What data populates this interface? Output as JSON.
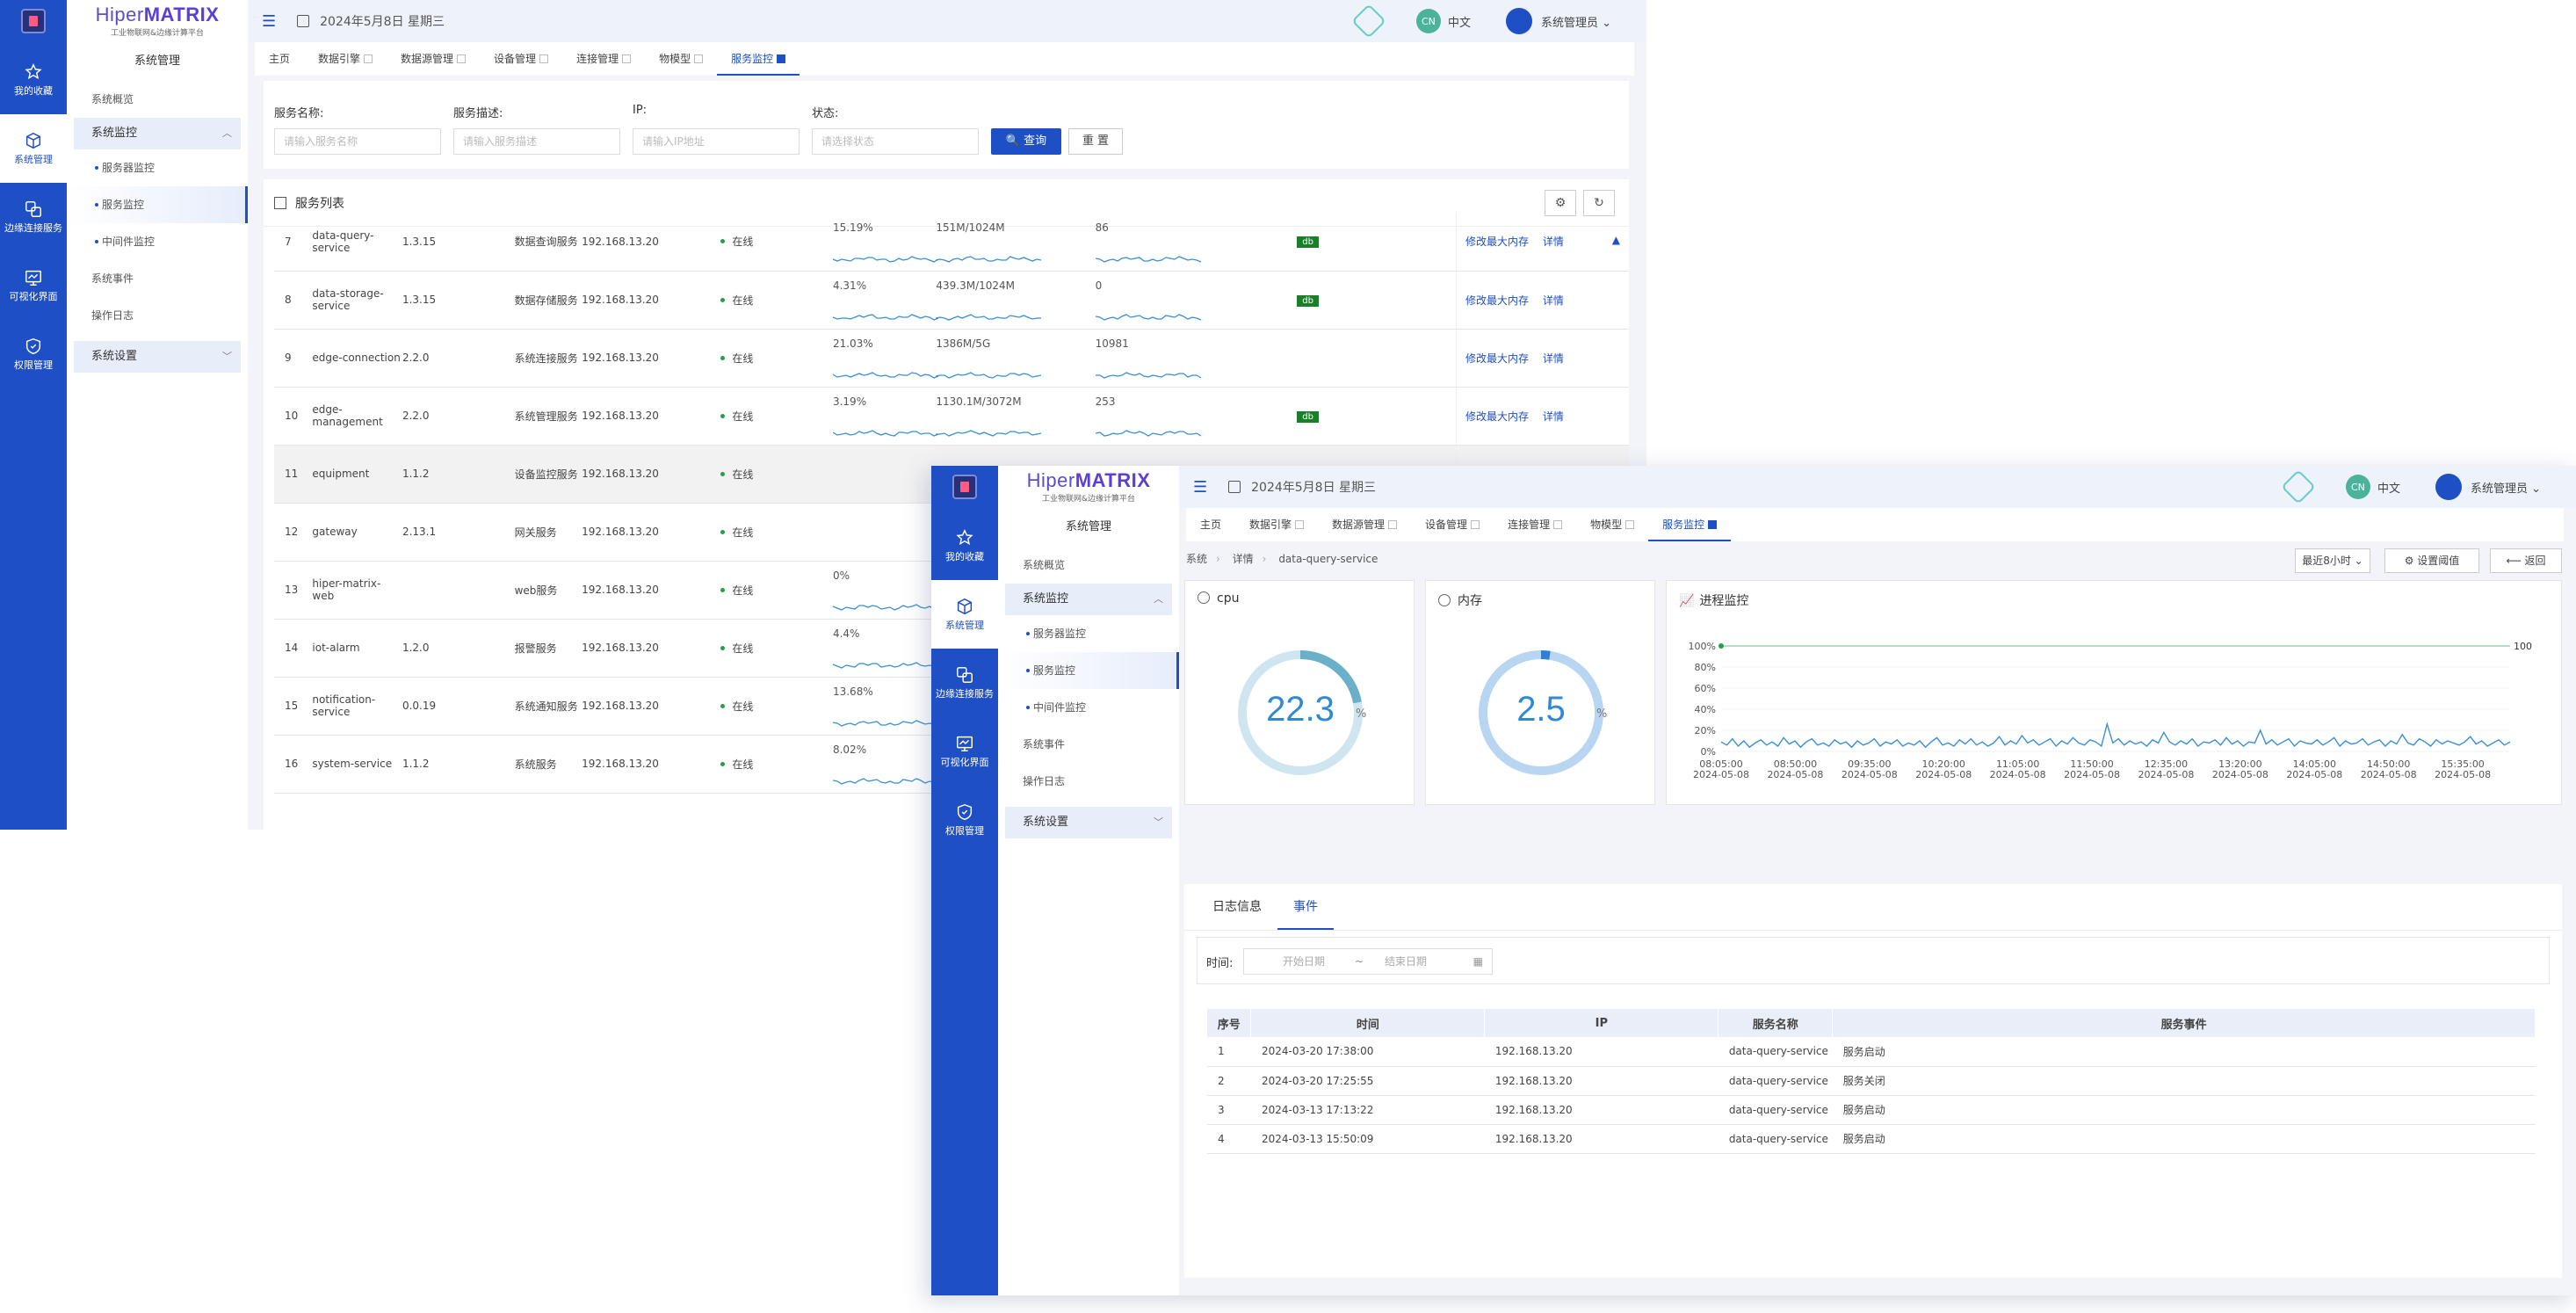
{
  "common": {
    "brand_main": "Hiper",
    "brand_accent": "MATRIX",
    "brand_sub": "工业物联网&边缘计算平台",
    "date": "2024年5月8日 星期三",
    "lang_badge": "CN",
    "lang_label": "中文",
    "user_label": "系统管理员 ⌄",
    "rail": [
      {
        "label": "我的收藏",
        "icon": "star-icon"
      },
      {
        "label": "系统管理",
        "icon": "cube-icon"
      },
      {
        "label": "边缘连接服务",
        "icon": "link-icon"
      },
      {
        "label": "可视化界面",
        "icon": "monitor-icon"
      },
      {
        "label": "权限管理",
        "icon": "shield-icon"
      }
    ],
    "sidebar": {
      "title": "系统管理",
      "overview": "系统概览",
      "monitor_group": "系统监控",
      "subs": [
        "服务器监控",
        "服务监控",
        "中间件监控"
      ],
      "events": "系统事件",
      "oplog": "操作日志",
      "settings": "系统设置"
    },
    "tabs": [
      "主页",
      "数据引擎",
      "数据源管理",
      "设备管理",
      "连接管理",
      "物模型",
      "服务监控"
    ]
  },
  "list_page": {
    "filters": {
      "name_label": "服务名称:",
      "name_placeholder": "请输入服务名称",
      "desc_label": "服务描述:",
      "desc_placeholder": "请输入服务描述",
      "ip_label": "IP:",
      "ip_placeholder": "请输入IP地址",
      "status_label": "状态:",
      "status_placeholder": "请选择状态",
      "query_button": "🔍 查询",
      "reset_button": "重 置"
    },
    "list_title": "服务列表",
    "rows": [
      {
        "no": "7",
        "name": "data-query-service",
        "ver": "1.3.15",
        "desc": "数据查询服务",
        "ip": "192.168.13.20",
        "status": "在线",
        "cpu": "15.19%",
        "mem": "151M/1024M",
        "thr": "86",
        "tag": "db",
        "mod": "修改最大内存",
        "detail": "详情"
      },
      {
        "no": "8",
        "name": "data-storage-service",
        "ver": "1.3.15",
        "desc": "数据存储服务",
        "ip": "192.168.13.20",
        "status": "在线",
        "cpu": "4.31%",
        "mem": "439.3M/1024M",
        "thr": "0",
        "tag": "db",
        "mod": "修改最大内存",
        "detail": "详情"
      },
      {
        "no": "9",
        "name": "edge-connection",
        "ver": "2.2.0",
        "desc": "系统连接服务",
        "ip": "192.168.13.20",
        "status": "在线",
        "cpu": "21.03%",
        "mem": "1386M/5G",
        "thr": "10981",
        "tag": "",
        "mod": "修改最大内存",
        "detail": "详情"
      },
      {
        "no": "10",
        "name": "edge-management",
        "ver": "2.2.0",
        "desc": "系统管理服务",
        "ip": "192.168.13.20",
        "status": "在线",
        "cpu": "3.19%",
        "mem": "1130.1M/3072M",
        "thr": "253",
        "tag": "db",
        "mod": "修改最大内存",
        "detail": "详情"
      },
      {
        "no": "11",
        "name": "equipment",
        "ver": "1.1.2",
        "desc": "设备监控服务",
        "ip": "192.168.13.20",
        "status": "在线",
        "cpu": "",
        "mem": "",
        "thr": "",
        "tag": "",
        "mod": "",
        "detail": ""
      },
      {
        "no": "12",
        "name": "gateway",
        "ver": "2.13.1",
        "desc": "网关服务",
        "ip": "192.168.13.20",
        "status": "在线",
        "cpu": "",
        "mem": "",
        "thr": "",
        "tag": "",
        "mod": "",
        "detail": ""
      },
      {
        "no": "13",
        "name": "hiper-matrix-web",
        "ver": "",
        "desc": "web服务",
        "ip": "192.168.13.20",
        "status": "在线",
        "cpu": "0%",
        "mem": "",
        "thr": "",
        "tag": "",
        "mod": "",
        "detail": ""
      },
      {
        "no": "14",
        "name": "iot-alarm",
        "ver": "1.2.0",
        "desc": "报警服务",
        "ip": "192.168.13.20",
        "status": "在线",
        "cpu": "4.4%",
        "mem": "",
        "thr": "",
        "tag": "",
        "mod": "",
        "detail": ""
      },
      {
        "no": "15",
        "name": "notification-service",
        "ver": "0.0.19",
        "desc": "系统通知服务",
        "ip": "192.168.13.20",
        "status": "在线",
        "cpu": "13.68%",
        "mem": "",
        "thr": "",
        "tag": "",
        "mod": "",
        "detail": ""
      },
      {
        "no": "16",
        "name": "system-service",
        "ver": "1.1.2",
        "desc": "系统服务",
        "ip": "192.168.13.20",
        "status": "在线",
        "cpu": "8.02%",
        "mem": "",
        "thr": "",
        "tag": "",
        "mod": "",
        "detail": ""
      }
    ]
  },
  "detail_page": {
    "breadcrumb": [
      "系统",
      "详情",
      "data-query-service"
    ],
    "range_select": "最近8小时 ⌄",
    "threshold_button": "⚙ 设置阈值",
    "back_button": "⟵ 返回",
    "cpu_title": "cpu",
    "cpu_value": "22.3",
    "cpu_unit": "%",
    "mem_title": "内存",
    "mem_value": "2.5",
    "mem_unit": "%",
    "proc_title": "进程监控",
    "event_tabs": [
      "日志信息",
      "事件"
    ],
    "time_label": "时间:",
    "start_placeholder": "开始日期",
    "end_placeholder": "结束日期",
    "event_headers": [
      "序号",
      "时间",
      "IP",
      "服务名称",
      "服务事件"
    ],
    "events": [
      {
        "no": "1",
        "time": "2024-03-20 17:38:00",
        "ip": "192.168.13.20",
        "svc": "data-query-service",
        "ev": "服务启动"
      },
      {
        "no": "2",
        "time": "2024-03-20 17:25:55",
        "ip": "192.168.13.20",
        "svc": "data-query-service",
        "ev": "服务关闭"
      },
      {
        "no": "3",
        "time": "2024-03-13 17:13:22",
        "ip": "192.168.13.20",
        "svc": "data-query-service",
        "ev": "服务启动"
      },
      {
        "no": "4",
        "time": "2024-03-13 15:50:09",
        "ip": "192.168.13.20",
        "svc": "data-query-service",
        "ev": "服务启动"
      }
    ]
  },
  "chart_data": {
    "type": "line",
    "title": "进程监控",
    "y_ticks": [
      "100%",
      "80%",
      "60%",
      "40%",
      "20%",
      "0%"
    ],
    "ylim": [
      0,
      100
    ],
    "x_ticks": [
      [
        "08:05:00",
        "2024-05-08"
      ],
      [
        "08:50:00",
        "2024-05-08"
      ],
      [
        "09:35:00",
        "2024-05-08"
      ],
      [
        "10:20:00",
        "2024-05-08"
      ],
      [
        "11:05:00",
        "2024-05-08"
      ],
      [
        "11:50:00",
        "2024-05-08"
      ],
      [
        "12:35:00",
        "2024-05-08"
      ],
      [
        "13:20:00",
        "2024-05-08"
      ],
      [
        "14:05:00",
        "2024-05-08"
      ],
      [
        "14:50:00",
        "2024-05-08"
      ],
      [
        "15:35:00",
        "2024-05-08"
      ]
    ],
    "threshold": 100,
    "threshold_label": "100",
    "series": [
      {
        "values": [
          9,
          6,
          12,
          5,
          10,
          4,
          8,
          11,
          6,
          9,
          5,
          13,
          7,
          10,
          4,
          9,
          12,
          6,
          8,
          5,
          11,
          7,
          9,
          4,
          10,
          6,
          8,
          12,
          5,
          9,
          7,
          11,
          5,
          8,
          6,
          10,
          4,
          9,
          13,
          6,
          8,
          5,
          11,
          7,
          12,
          6,
          9,
          5,
          8,
          14,
          6,
          10,
          7,
          15,
          8,
          11,
          6,
          9,
          12,
          5,
          10,
          7,
          13,
          8,
          6,
          11,
          9,
          5,
          26,
          8,
          12,
          6,
          10,
          7,
          9,
          5,
          11,
          8,
          18,
          9,
          6,
          10,
          7,
          12,
          5,
          9,
          8,
          11,
          6,
          13,
          7,
          10,
          5,
          9,
          8,
          20,
          7,
          11,
          6,
          9,
          12,
          5,
          10,
          8,
          7,
          11,
          6,
          9,
          13,
          5,
          10,
          7,
          8,
          12,
          6,
          9,
          11,
          5,
          10,
          7,
          16,
          8,
          6,
          12,
          9,
          5,
          11,
          7,
          10,
          8,
          6,
          9,
          14,
          7,
          10,
          5,
          8,
          11,
          6,
          9
        ]
      }
    ]
  }
}
